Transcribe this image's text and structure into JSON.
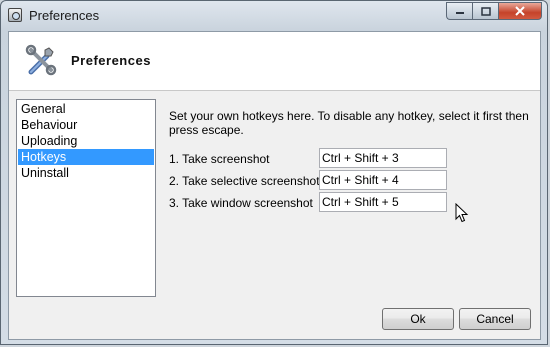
{
  "window": {
    "title": "Preferences"
  },
  "header": {
    "title": "Preferences",
    "icon": "tools-icon"
  },
  "nav": {
    "items": [
      {
        "label": "General",
        "selected": false
      },
      {
        "label": "Behaviour",
        "selected": false
      },
      {
        "label": "Uploading",
        "selected": false
      },
      {
        "label": "Hotkeys",
        "selected": true
      },
      {
        "label": "Uninstall",
        "selected": false
      }
    ]
  },
  "hotkeys": {
    "description": "Set your own hotkeys here. To disable any hotkey, select it first then press escape.",
    "rows": [
      {
        "label": "1. Take screenshot",
        "value": "Ctrl + Shift + 3"
      },
      {
        "label": "2. Take selective screenshot",
        "value": "Ctrl + Shift + 4"
      },
      {
        "label": "3. Take window screenshot",
        "value": "Ctrl + Shift + 5"
      }
    ]
  },
  "buttons": {
    "ok": "Ok",
    "cancel": "Cancel"
  },
  "colors": {
    "selection": "#3399ff",
    "close_button": "#c5432a"
  }
}
